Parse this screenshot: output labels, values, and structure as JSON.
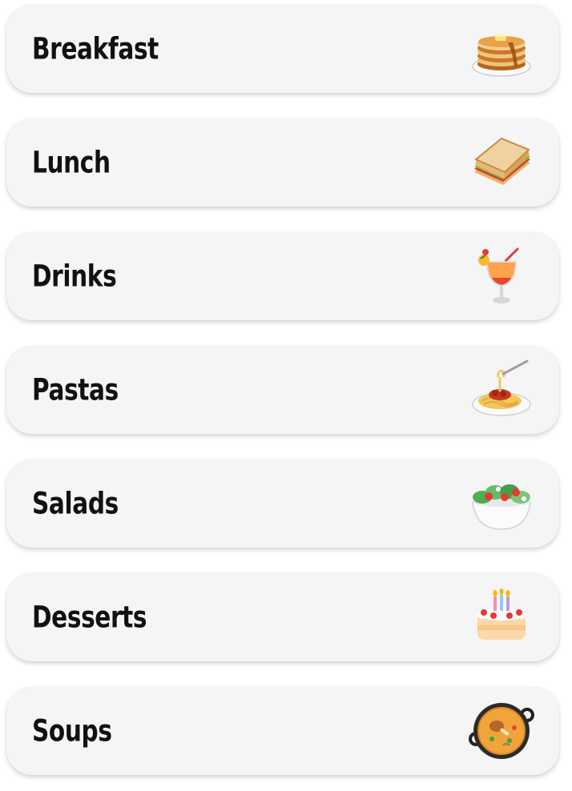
{
  "menu": {
    "items": [
      {
        "label": "Breakfast",
        "icon": "pancakes-icon"
      },
      {
        "label": "Lunch",
        "icon": "sandwich-icon"
      },
      {
        "label": "Drinks",
        "icon": "tropical-drink-icon"
      },
      {
        "label": "Pastas",
        "icon": "spaghetti-icon"
      },
      {
        "label": "Salads",
        "icon": "green-salad-icon"
      },
      {
        "label": "Desserts",
        "icon": "birthday-cake-icon"
      },
      {
        "label": "Soups",
        "icon": "shallow-pan-of-food-icon"
      }
    ]
  },
  "colors": {
    "card_background": "#f5f5f5",
    "label_text": "#111111",
    "page_background": "#ffffff"
  }
}
